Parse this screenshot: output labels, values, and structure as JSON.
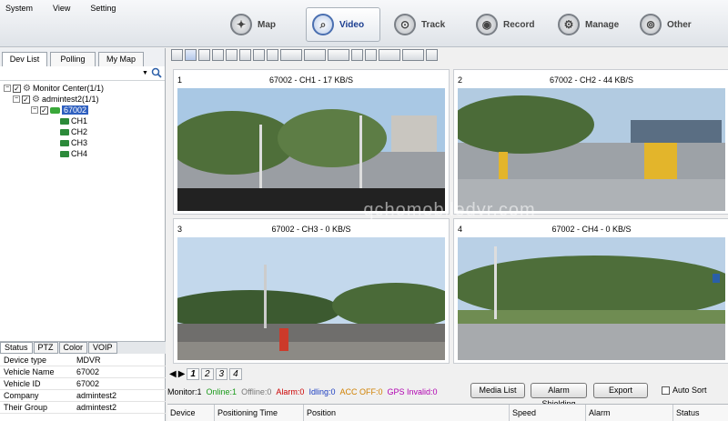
{
  "menu": [
    "System",
    "View",
    "Setting"
  ],
  "nav": [
    {
      "label": "Map",
      "icon": "map-icon",
      "active": false
    },
    {
      "label": "Video",
      "icon": "video-icon",
      "active": true
    },
    {
      "label": "Track",
      "icon": "track-icon",
      "active": false
    },
    {
      "label": "Record",
      "icon": "record-icon",
      "active": false
    },
    {
      "label": "Manage",
      "icon": "manage-icon",
      "active": false
    },
    {
      "label": "Other",
      "icon": "other-icon",
      "active": false
    }
  ],
  "left_tabs": [
    "Dev List",
    "Polling",
    "My Map"
  ],
  "tree": {
    "root": "Monitor Center(1/1)",
    "group": "admintest2(1/1)",
    "device": "67002",
    "channels": [
      "CH1",
      "CH2",
      "CH3",
      "CH4"
    ]
  },
  "info_tabs": [
    "Status",
    "PTZ",
    "Color",
    "VOIP"
  ],
  "info": [
    {
      "k": "Device type",
      "v": "MDVR"
    },
    {
      "k": "Vehicle Name",
      "v": "67002"
    },
    {
      "k": "Vehicle ID",
      "v": "67002"
    },
    {
      "k": "Company",
      "v": "admintest2"
    },
    {
      "k": "Their Group",
      "v": "admintest2"
    }
  ],
  "videos": [
    {
      "num": "1",
      "caption": "67002 - CH1 - 17 KB/S",
      "scene": "street-trees"
    },
    {
      "num": "2",
      "caption": "67002 - CH2 - 44 KB/S",
      "scene": "road-bollards"
    },
    {
      "num": "3",
      "caption": "67002 - CH3 - 0 KB/S",
      "scene": "sky-road"
    },
    {
      "num": "4",
      "caption": "67002 - CH4 - 0 KB/S",
      "scene": "park-road"
    }
  ],
  "watermark": "qchomobiledvr.com",
  "page_tabs": [
    "1",
    "2",
    "3",
    "4"
  ],
  "status": {
    "monitor": "Monitor:1",
    "online": "Online:1",
    "offline": "Offline:0",
    "alarm": "Alarm:0",
    "idling": "Idling:0",
    "acc_off": "ACC OFF:0",
    "gps_invalid": "GPS Invalid:0"
  },
  "buttons": {
    "media_list": "Media List",
    "alarm_shielding": "Alarm Shielding",
    "export": "Export",
    "auto_sort": "Auto Sort"
  },
  "columns": [
    "Device",
    "Positioning Time",
    "Position",
    "Speed",
    "Alarm",
    "Status"
  ],
  "colors": {
    "online": "#1a9a1a",
    "offline": "#777777",
    "alarm": "#cc0000",
    "idling": "#1a3cc0",
    "acc_off": "#d08000",
    "gps_invalid": "#b000b0"
  }
}
